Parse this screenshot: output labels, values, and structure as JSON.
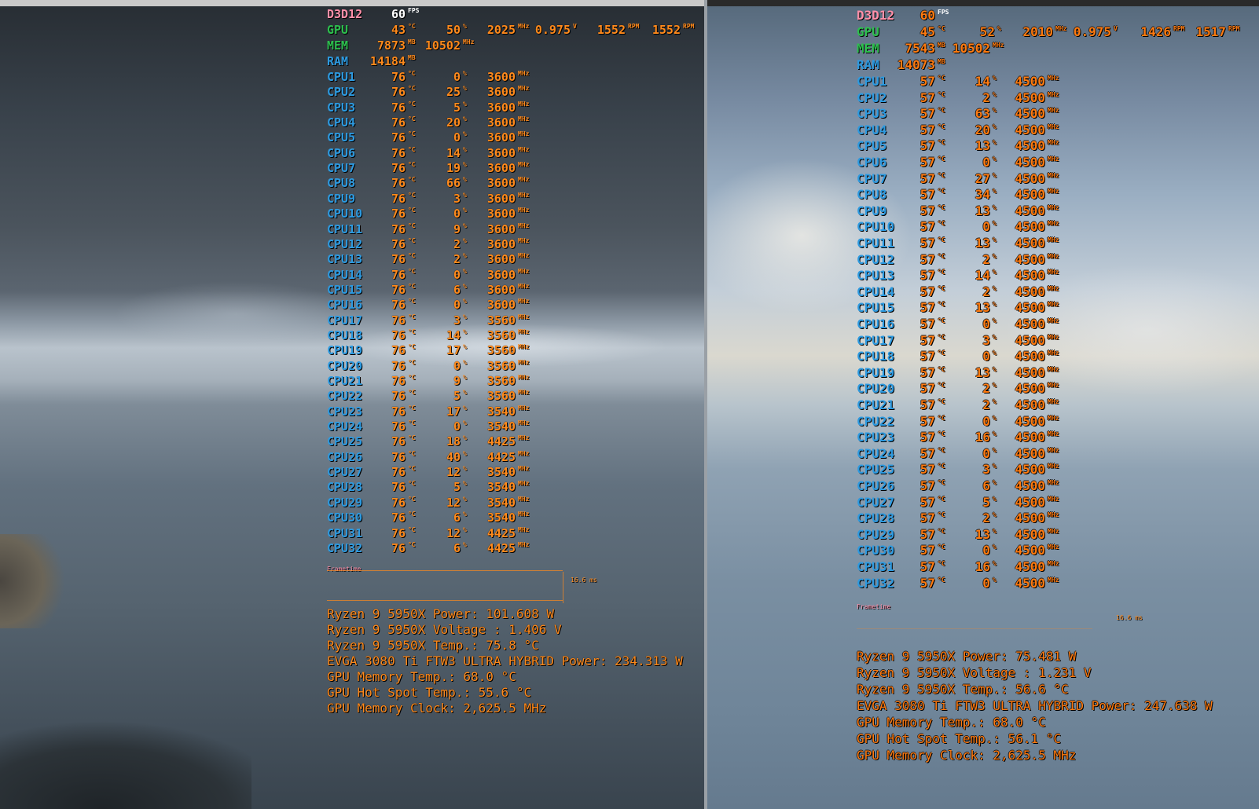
{
  "left": {
    "api": "D3D12",
    "fps": "60",
    "fps_unit": "FPS",
    "gpu": {
      "label": "GPU",
      "temp": "43",
      "temp_unit": "°C",
      "load": "50",
      "load_unit": "%",
      "clock": "2025",
      "clock_unit": "MHz",
      "voltage": "0.975",
      "voltage_unit": "V",
      "fan1": "1552",
      "fan1_unit": "RPM",
      "fan2": "1552",
      "fan2_unit": "RPM"
    },
    "mem": {
      "label": "MEM",
      "used": "7873",
      "used_unit": "MB",
      "clock": "10502",
      "clock_unit": "MHz"
    },
    "ram": {
      "label": "RAM",
      "used": "14184",
      "used_unit": "MB"
    },
    "cpus": [
      {
        "label": "CPU1",
        "temp": "76",
        "load": "0",
        "clock": "3600"
      },
      {
        "label": "CPU2",
        "temp": "76",
        "load": "25",
        "clock": "3600"
      },
      {
        "label": "CPU3",
        "temp": "76",
        "load": "5",
        "clock": "3600"
      },
      {
        "label": "CPU4",
        "temp": "76",
        "load": "20",
        "clock": "3600"
      },
      {
        "label": "CPU5",
        "temp": "76",
        "load": "0",
        "clock": "3600"
      },
      {
        "label": "CPU6",
        "temp": "76",
        "load": "14",
        "clock": "3600"
      },
      {
        "label": "CPU7",
        "temp": "76",
        "load": "19",
        "clock": "3600"
      },
      {
        "label": "CPU8",
        "temp": "76",
        "load": "66",
        "clock": "3600"
      },
      {
        "label": "CPU9",
        "temp": "76",
        "load": "3",
        "clock": "3600"
      },
      {
        "label": "CPU10",
        "temp": "76",
        "load": "0",
        "clock": "3600"
      },
      {
        "label": "CPU11",
        "temp": "76",
        "load": "9",
        "clock": "3600"
      },
      {
        "label": "CPU12",
        "temp": "76",
        "load": "2",
        "clock": "3600"
      },
      {
        "label": "CPU13",
        "temp": "76",
        "load": "2",
        "clock": "3600"
      },
      {
        "label": "CPU14",
        "temp": "76",
        "load": "0",
        "clock": "3600"
      },
      {
        "label": "CPU15",
        "temp": "76",
        "load": "6",
        "clock": "3600"
      },
      {
        "label": "CPU16",
        "temp": "76",
        "load": "0",
        "clock": "3600"
      },
      {
        "label": "CPU17",
        "temp": "76",
        "load": "3",
        "clock": "3560"
      },
      {
        "label": "CPU18",
        "temp": "76",
        "load": "14",
        "clock": "3560"
      },
      {
        "label": "CPU19",
        "temp": "76",
        "load": "17",
        "clock": "3560"
      },
      {
        "label": "CPU20",
        "temp": "76",
        "load": "0",
        "clock": "3560"
      },
      {
        "label": "CPU21",
        "temp": "76",
        "load": "9",
        "clock": "3560"
      },
      {
        "label": "CPU22",
        "temp": "76",
        "load": "5",
        "clock": "3560"
      },
      {
        "label": "CPU23",
        "temp": "76",
        "load": "17",
        "clock": "3540"
      },
      {
        "label": "CPU24",
        "temp": "76",
        "load": "0",
        "clock": "3540"
      },
      {
        "label": "CPU25",
        "temp": "76",
        "load": "18",
        "clock": "4425"
      },
      {
        "label": "CPU26",
        "temp": "76",
        "load": "40",
        "clock": "4425"
      },
      {
        "label": "CPU27",
        "temp": "76",
        "load": "12",
        "clock": "3540"
      },
      {
        "label": "CPU28",
        "temp": "76",
        "load": "5",
        "clock": "3540"
      },
      {
        "label": "CPU29",
        "temp": "76",
        "load": "12",
        "clock": "3540"
      },
      {
        "label": "CPU30",
        "temp": "76",
        "load": "6",
        "clock": "3540"
      },
      {
        "label": "CPU31",
        "temp": "76",
        "load": "12",
        "clock": "4425"
      },
      {
        "label": "CPU32",
        "temp": "76",
        "load": "6",
        "clock": "4425"
      }
    ],
    "frametime_label": "Frametime",
    "frametime_value": "16.6 ms",
    "stats": [
      "Ryzen 9 5950X Power: 101.608 W",
      "Ryzen 9 5950X Voltage : 1.406 V",
      "Ryzen 9 5950X Temp.: 75.8 °C",
      "EVGA  3080 Ti FTW3 ULTRA HYBRID  Power: 234.313 W",
      "GPU Memory  Temp.: 68.0 °C",
      "GPU Hot Spot Temp.: 55.6 °C",
      "GPU Memory Clock: 2,625.5 MHz"
    ]
  },
  "right": {
    "api": "D3D12",
    "fps": "60",
    "fps_unit": "FPS",
    "gpu": {
      "label": "GPU",
      "temp": "45",
      "temp_unit": "°C",
      "load": "52",
      "load_unit": "%",
      "clock": "2010",
      "clock_unit": "MHz",
      "voltage": "0.975",
      "voltage_unit": "V",
      "fan1": "1426",
      "fan1_unit": "RPM",
      "fan2": "1517",
      "fan2_unit": "RPM"
    },
    "mem": {
      "label": "MEM",
      "used": "7543",
      "used_unit": "MB",
      "clock": "10502",
      "clock_unit": "MHz"
    },
    "ram": {
      "label": "RAM",
      "used": "14073",
      "used_unit": "MB"
    },
    "cpus": [
      {
        "label": "CPU1",
        "temp": "57",
        "load": "14",
        "clock": "4500"
      },
      {
        "label": "CPU2",
        "temp": "57",
        "load": "2",
        "clock": "4500"
      },
      {
        "label": "CPU3",
        "temp": "57",
        "load": "63",
        "clock": "4500"
      },
      {
        "label": "CPU4",
        "temp": "57",
        "load": "20",
        "clock": "4500"
      },
      {
        "label": "CPU5",
        "temp": "57",
        "load": "13",
        "clock": "4500"
      },
      {
        "label": "CPU6",
        "temp": "57",
        "load": "0",
        "clock": "4500"
      },
      {
        "label": "CPU7",
        "temp": "57",
        "load": "27",
        "clock": "4500"
      },
      {
        "label": "CPU8",
        "temp": "57",
        "load": "34",
        "clock": "4500"
      },
      {
        "label": "CPU9",
        "temp": "57",
        "load": "13",
        "clock": "4500"
      },
      {
        "label": "CPU10",
        "temp": "57",
        "load": "0",
        "clock": "4500"
      },
      {
        "label": "CPU11",
        "temp": "57",
        "load": "13",
        "clock": "4500"
      },
      {
        "label": "CPU12",
        "temp": "57",
        "load": "2",
        "clock": "4500"
      },
      {
        "label": "CPU13",
        "temp": "57",
        "load": "14",
        "clock": "4500"
      },
      {
        "label": "CPU14",
        "temp": "57",
        "load": "2",
        "clock": "4500"
      },
      {
        "label": "CPU15",
        "temp": "57",
        "load": "13",
        "clock": "4500"
      },
      {
        "label": "CPU16",
        "temp": "57",
        "load": "0",
        "clock": "4500"
      },
      {
        "label": "CPU17",
        "temp": "57",
        "load": "3",
        "clock": "4500"
      },
      {
        "label": "CPU18",
        "temp": "57",
        "load": "0",
        "clock": "4500"
      },
      {
        "label": "CPU19",
        "temp": "57",
        "load": "13",
        "clock": "4500"
      },
      {
        "label": "CPU20",
        "temp": "57",
        "load": "2",
        "clock": "4500"
      },
      {
        "label": "CPU21",
        "temp": "57",
        "load": "2",
        "clock": "4500"
      },
      {
        "label": "CPU22",
        "temp": "57",
        "load": "0",
        "clock": "4500"
      },
      {
        "label": "CPU23",
        "temp": "57",
        "load": "16",
        "clock": "4500"
      },
      {
        "label": "CPU24",
        "temp": "57",
        "load": "0",
        "clock": "4500"
      },
      {
        "label": "CPU25",
        "temp": "57",
        "load": "3",
        "clock": "4500"
      },
      {
        "label": "CPU26",
        "temp": "57",
        "load": "6",
        "clock": "4500"
      },
      {
        "label": "CPU27",
        "temp": "57",
        "load": "5",
        "clock": "4500"
      },
      {
        "label": "CPU28",
        "temp": "57",
        "load": "2",
        "clock": "4500"
      },
      {
        "label": "CPU29",
        "temp": "57",
        "load": "13",
        "clock": "4500"
      },
      {
        "label": "CPU30",
        "temp": "57",
        "load": "0",
        "clock": "4500"
      },
      {
        "label": "CPU31",
        "temp": "57",
        "load": "16",
        "clock": "4500"
      },
      {
        "label": "CPU32",
        "temp": "57",
        "load": "0",
        "clock": "4500"
      }
    ],
    "frametime_label": "Frametime",
    "frametime_value": "16.6 ms",
    "stats": [
      "Ryzen 9 5950X Power: 75.481 W",
      "Ryzen 9 5950X Voltage : 1.231 V",
      "Ryzen 9 5950X Temp.: 56.6 °C",
      "EVGA  3080 Ti FTW3 ULTRA HYBRID  Power: 247.638 W",
      "GPU Memory  Temp.: 68.0 °C",
      "GPU Hot Spot Temp.: 56.1 °C",
      "GPU Memory Clock: 2,625.5 MHz"
    ]
  },
  "units": {
    "temp": "°C",
    "load": "%",
    "clock": "MHz"
  },
  "colors": {
    "value": "#ff8a1c",
    "gpu_label": "#2dbf4e",
    "cpu_label": "#2d9ae0",
    "api_label": "#ff8fa8",
    "fps": "#ffffff"
  }
}
